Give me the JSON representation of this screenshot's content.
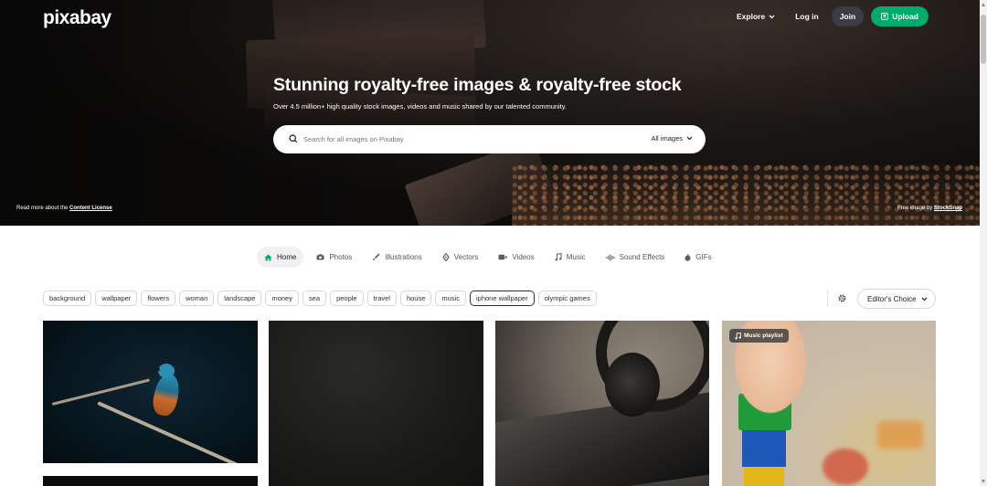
{
  "header": {
    "logo": "pixabay",
    "explore_label": "Explore",
    "login_label": "Log in",
    "join_label": "Join",
    "upload_label": "Upload"
  },
  "hero": {
    "title": "Stunning royalty-free images & royalty-free stock",
    "subtitle": "Over 4.5 million+ high quality stock images, videos and music shared by our talented community.",
    "search_placeholder": "Search for all images on Pixabay",
    "search_scope": "All images",
    "license_prefix": "Read more about the ",
    "license_link": "Content License",
    "credit_prefix": "Free image by ",
    "credit_link": "StockSnap"
  },
  "tabs": [
    {
      "label": "Home",
      "icon": "home-icon",
      "active": true
    },
    {
      "label": "Photos",
      "icon": "camera-icon"
    },
    {
      "label": "Illustrations",
      "icon": "brush-icon"
    },
    {
      "label": "Vectors",
      "icon": "pen-nib-icon"
    },
    {
      "label": "Videos",
      "icon": "video-camera-icon"
    },
    {
      "label": "Music",
      "icon": "music-note-icon"
    },
    {
      "label": "Sound Effects",
      "icon": "waveform-icon"
    },
    {
      "label": "GIFs",
      "icon": "flame-icon"
    }
  ],
  "tags": [
    "background",
    "wallpaper",
    "flowers",
    "woman",
    "landscape",
    "money",
    "sea",
    "people",
    "travel",
    "house",
    "music",
    "iphone wallpaper",
    "olympic games"
  ],
  "sort": {
    "label": "Editor's Choice"
  },
  "grid": {
    "badge_label": "Music playlist"
  },
  "colors": {
    "accent": "#00ab6b",
    "join_bg": "#3a3d44",
    "text": "#191b26"
  }
}
